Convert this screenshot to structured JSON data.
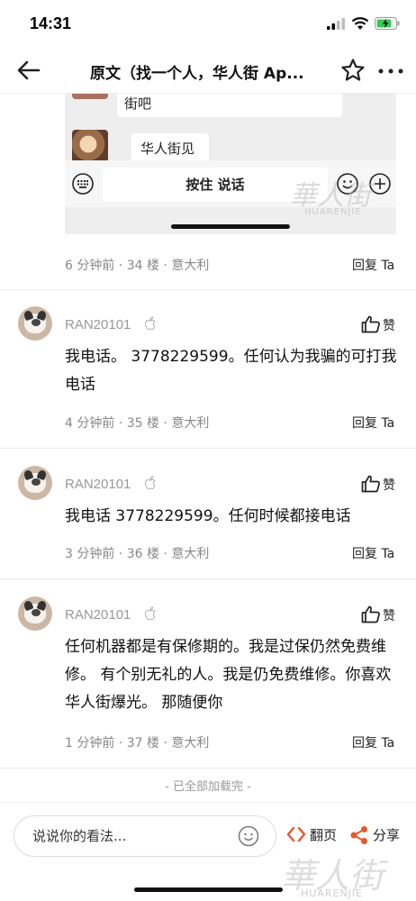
{
  "status_bar": {
    "time": "14:31"
  },
  "nav": {
    "title": "原文（找一个人，华人街 Ap..."
  },
  "screenshot": {
    "bubble_top": "街吧",
    "bubble_chat": "华人街见",
    "hold_to_talk": "按住 说话",
    "watermark": "華人街",
    "watermark_sub": "HUARENJIE"
  },
  "comments": [
    {
      "meta": "6 分钟前 · 34 楼 · 意大利",
      "reply": "回复 Ta"
    },
    {
      "username": "RAN20101",
      "like": "赞",
      "body": "我电话。 3778229599。任何认为我骗的可打我电话",
      "meta": "4 分钟前 · 35 楼 · 意大利",
      "reply": "回复 Ta"
    },
    {
      "username": "RAN20101",
      "like": "赞",
      "body": "我电话 3778229599。任何时候都接电话",
      "meta": "3 分钟前 · 36 楼 · 意大利",
      "reply": "回复 Ta"
    },
    {
      "username": "RAN20101",
      "like": "赞",
      "body": "任何机器都是有保修期的。我是过保仍然免费维修。 有个别无礼的人。我是仍免费维修。你喜欢华人街爆光。 那随便你",
      "meta": "1 分钟前 · 37 楼 · 意大利",
      "reply": "回复 Ta"
    }
  ],
  "all_loaded": "- 已全部加载完 -",
  "bottom": {
    "placeholder": "说说你的看法...",
    "translate": "翻页",
    "share": "分享",
    "watermark": "華人街",
    "watermark_sub": "HUARENJIE"
  },
  "colors": {
    "accent": "#e8562a"
  }
}
